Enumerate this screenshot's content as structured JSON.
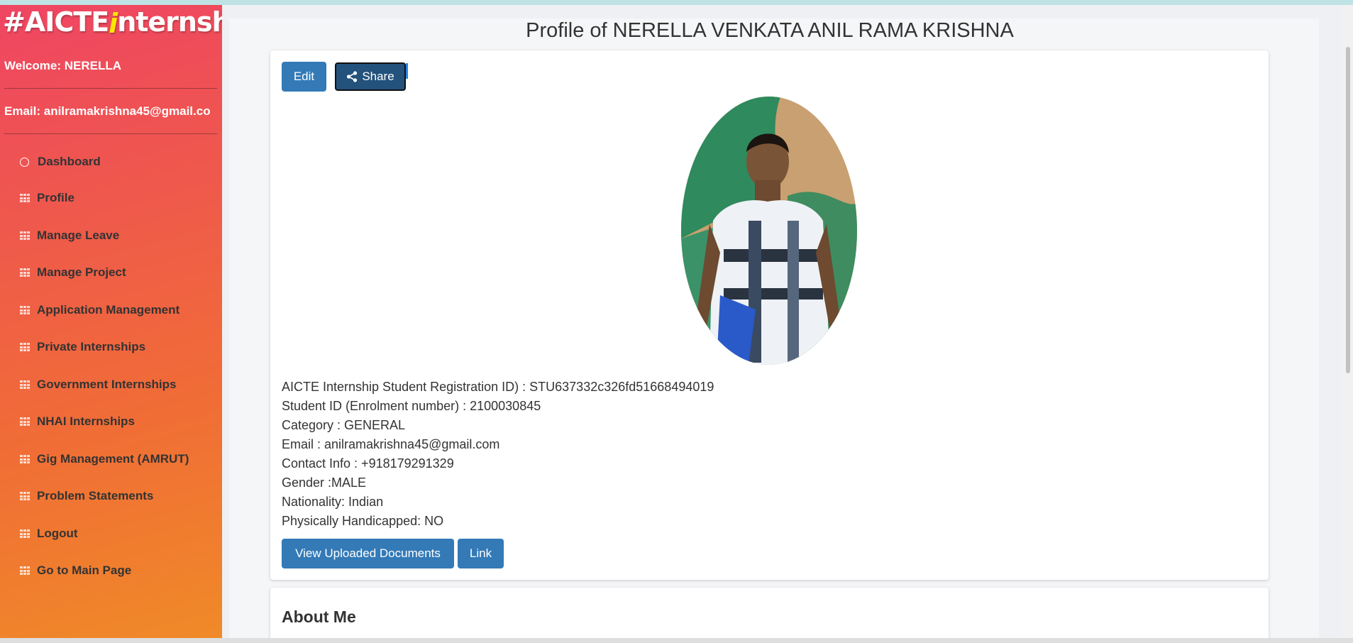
{
  "sidebar": {
    "brand_prefix": "#AICTE",
    "brand_i": "i",
    "brand_suffix": "nternship",
    "welcome": "Welcome: NERELLA",
    "email": "Email: anilramakrishna45@gmail.co",
    "items": [
      {
        "label": "Dashboard",
        "icon": "circle-icon"
      },
      {
        "label": "Profile",
        "icon": "grid-icon"
      },
      {
        "label": "Manage Leave",
        "icon": "grid-icon"
      },
      {
        "label": "Manage Project",
        "icon": "grid-icon"
      },
      {
        "label": "Application Management",
        "icon": "grid-icon"
      },
      {
        "label": "Private Internships",
        "icon": "grid-icon"
      },
      {
        "label": "Government Internships",
        "icon": "grid-icon"
      },
      {
        "label": "NHAI Internships",
        "icon": "grid-icon"
      },
      {
        "label": "Gig Management (AMRUT)",
        "icon": "grid-icon"
      },
      {
        "label": "Problem Statements",
        "icon": "grid-icon"
      },
      {
        "label": "Logout",
        "icon": "grid-icon"
      },
      {
        "label": "Go to Main Page",
        "icon": "grid-icon"
      }
    ]
  },
  "page": {
    "title": "Profile of NERELLA VENKATA ANIL RAMA KRISHNA"
  },
  "profile": {
    "edit_label": "Edit",
    "share_label": "Share",
    "details": [
      "AICTE Internship Student Registration ID) : STU637332c326fd51668494019",
      "Student ID (Enrolment number) : 2100030845",
      "Category : GENERAL",
      "Email : anilramakrishna45@gmail.com",
      "Contact Info : +918179291329",
      "Gender :MALE",
      "Nationality: Indian",
      "Physically Handicapped: NO"
    ],
    "view_docs_label": "View Uploaded Documents",
    "link_label": "Link"
  },
  "about": {
    "title": "About Me"
  },
  "colors": {
    "primary_button": "#337ab7",
    "share_button": "#23527c",
    "sidebar_top": "#ef4563",
    "sidebar_bottom": "#f08a28",
    "brand_i": "#ffe600"
  }
}
